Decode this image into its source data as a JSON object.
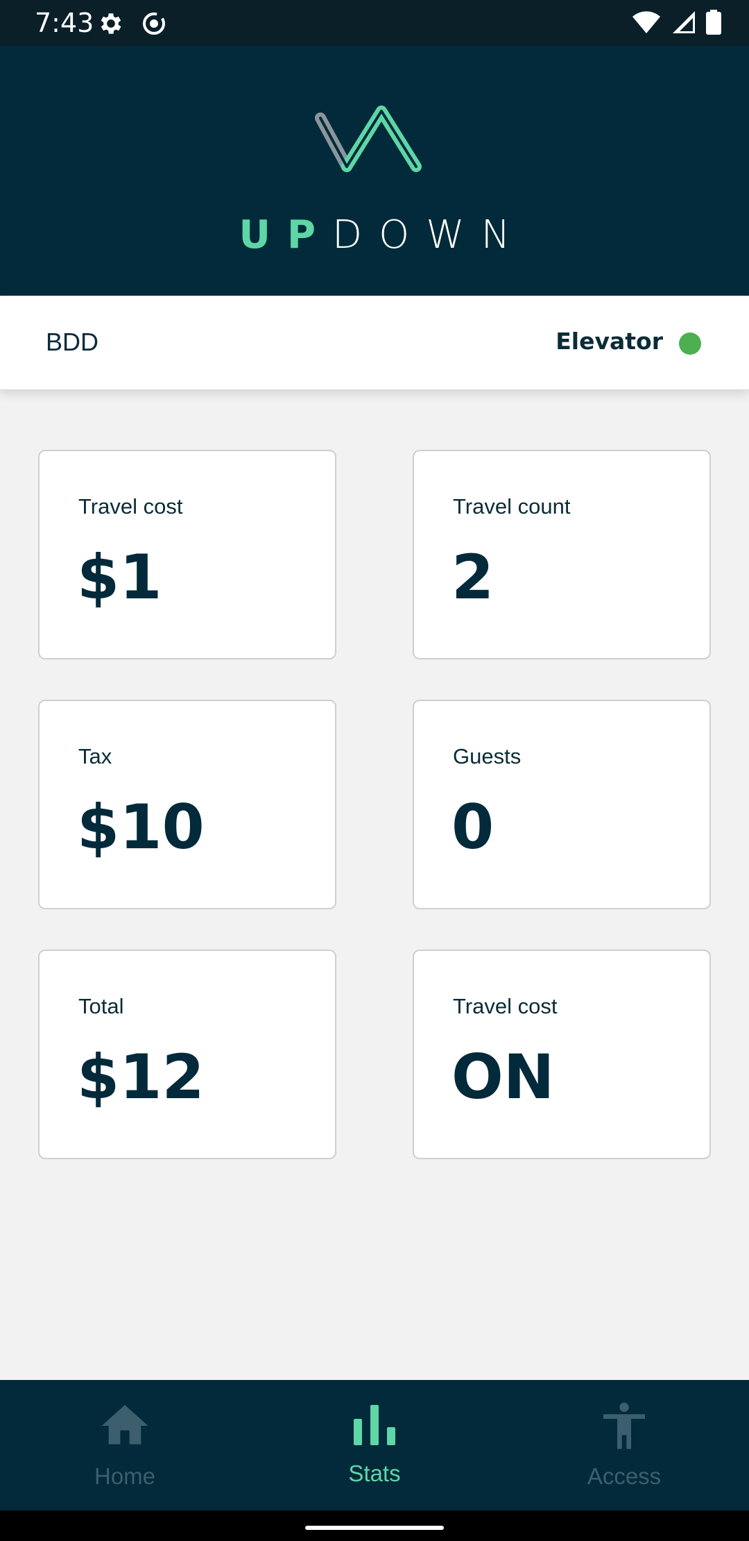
{
  "status_bar": {
    "time": "7:43",
    "left_icons": [
      "gear-icon",
      "record-icon"
    ],
    "right_icons": [
      "wifi-icon",
      "signal-icon",
      "battery-icon"
    ]
  },
  "header": {
    "logo_up": "UP",
    "logo_down": "DOWN",
    "colors": {
      "background": "#022a3a",
      "accent": "#5ed6a5"
    }
  },
  "info_bar": {
    "building": "BDD",
    "elevator_label": "Elevator",
    "elevator_status_color": "#4caf50"
  },
  "cards": [
    {
      "label": "Travel cost",
      "value": "$1"
    },
    {
      "label": "Travel count",
      "value": "2"
    },
    {
      "label": "Tax",
      "value": "$10"
    },
    {
      "label": "Guests",
      "value": "0"
    },
    {
      "label": "Total",
      "value": "$12"
    },
    {
      "label": "Travel cost",
      "value": "ON"
    }
  ],
  "bottom_nav": {
    "items": [
      {
        "label": "Home",
        "icon": "home-icon",
        "active": false
      },
      {
        "label": "Stats",
        "icon": "bar-chart-icon",
        "active": true
      },
      {
        "label": "Access",
        "icon": "accessibility-icon",
        "active": false
      }
    ],
    "colors": {
      "active": "#5ed6a5",
      "inactive": "#3d5f6d"
    }
  }
}
